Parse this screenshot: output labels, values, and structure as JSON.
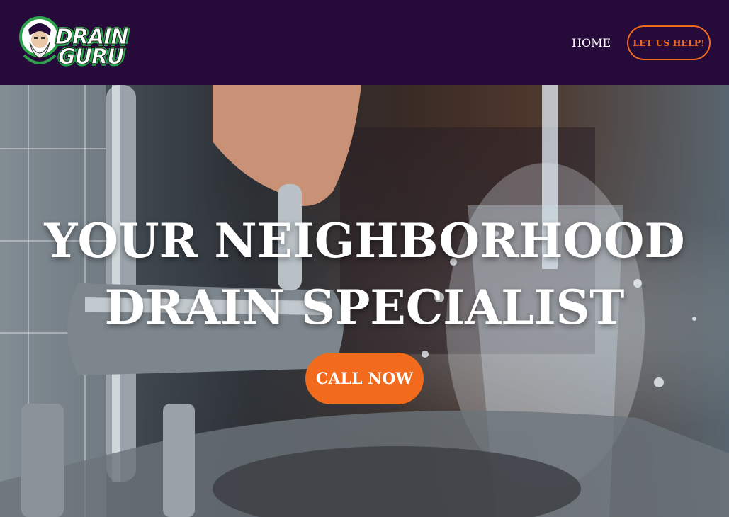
{
  "brand": {
    "logo_line1": "DRAIN",
    "logo_line2": "GURU",
    "colors": {
      "header_bg": "#250a3a",
      "accent": "#f26a1c",
      "logo_green": "#2aa24a"
    }
  },
  "nav": {
    "home_label": "HOME",
    "cta_label": "LET US HELP!"
  },
  "hero": {
    "headline_line1": "YOUR NEIGHBORHOOD",
    "headline_line2": "DRAIN SPECIALIST",
    "cta_label": "CALL NOW",
    "background_icon": "faucet-water-splash-photo"
  }
}
